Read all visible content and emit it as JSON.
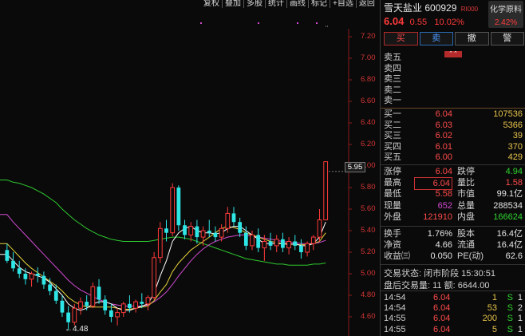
{
  "toolbar": [
    "复权",
    "叠加",
    "多股",
    "统计",
    "画线",
    "标记",
    "+自选",
    "返回"
  ],
  "price_axis": [
    "7.20",
    "7.00",
    "6.80",
    "6.60",
    "6.40",
    "6.20",
    "6.00",
    "5.80",
    "5.60",
    "5.40",
    "5.20",
    "5.00",
    "4.80",
    "4.60"
  ],
  "current_price_label": "5.95",
  "low_marker": "←4.48",
  "colors": {
    "up": "#ff3a3a",
    "down": "#2fe6e6",
    "ma5": "#ffffff",
    "ma10": "#e6d23a",
    "ma20": "#d04ad0",
    "ma60": "#2ec82e"
  },
  "header": {
    "name": "雪天盐业",
    "code": "600929",
    "badge": "RI000",
    "price": "6.04",
    "change": "0.55",
    "pct": "10.02%",
    "sector_name": "化学原料",
    "sector_pct": "2.42%"
  },
  "buttons": {
    "buy": "买",
    "sell": "卖",
    "cancel": "撤",
    "alert": "警"
  },
  "collapse_icon": "⌃⌃",
  "asks": [
    {
      "label": "卖五",
      "price": "",
      "vol": ""
    },
    {
      "label": "卖四",
      "price": "",
      "vol": ""
    },
    {
      "label": "卖三",
      "price": "",
      "vol": ""
    },
    {
      "label": "卖二",
      "price": "",
      "vol": ""
    },
    {
      "label": "卖一",
      "price": "",
      "vol": ""
    }
  ],
  "bids": [
    {
      "label": "买一",
      "price": "6.04",
      "vol": "107536"
    },
    {
      "label": "买二",
      "price": "6.03",
      "vol": "5366"
    },
    {
      "label": "买三",
      "price": "6.02",
      "vol": "39"
    },
    {
      "label": "买四",
      "price": "6.01",
      "vol": "370"
    },
    {
      "label": "买五",
      "price": "6.00",
      "vol": "429"
    }
  ],
  "stats": [
    {
      "l1": "涨停",
      "v1": "6.04",
      "c1": "red",
      "l2": "跌停",
      "v2": "4.94",
      "c2": "green"
    },
    {
      "l1": "最高",
      "v1": "6.04",
      "c1": "red",
      "l2": "量比",
      "v2": "1.58",
      "c2": "red"
    },
    {
      "l1": "最低",
      "v1": "5.58",
      "c1": "red",
      "l2": "市值",
      "v2": "99.1亿",
      "c2": "white"
    },
    {
      "l1": "现量",
      "v1": "652",
      "c1": "magenta",
      "l2": "总量",
      "v2": "288534",
      "c2": "white"
    },
    {
      "l1": "外盘",
      "v1": "121910",
      "c1": "red",
      "l2": "内盘",
      "v2": "166624",
      "c2": "green"
    }
  ],
  "stats2": [
    {
      "l1": "换手",
      "v1": "1.76%",
      "c1": "white",
      "l2": "股本",
      "v2": "16.4亿",
      "c2": "white"
    },
    {
      "l1": "净资",
      "v1": "4.66",
      "c1": "white",
      "l2": "流通",
      "v2": "16.4亿",
      "c2": "white"
    },
    {
      "l1": "收益㈢",
      "v1": "0.050",
      "c1": "white",
      "l2": "PE(动)",
      "v2": "62.6",
      "c2": "white"
    }
  ],
  "status": {
    "trade_status": "交易状态: 闭市阶段 15:30:51",
    "after_hours": "盘后交易量: 11  额: 6644.00"
  },
  "ticks": [
    {
      "time": "14:54",
      "price": "6.04",
      "vol": "1",
      "side": "S",
      "n": "1"
    },
    {
      "time": "14:54",
      "price": "6.04",
      "vol": "53",
      "side": "S",
      "n": "2"
    },
    {
      "time": "14:55",
      "price": "6.04",
      "vol": "200",
      "side": "S",
      "n": "1"
    },
    {
      "time": "14:55",
      "price": "6.04",
      "vol": "5",
      "side": "S",
      "n": "1"
    }
  ],
  "chart_data": {
    "type": "candlestick",
    "ylim": [
      4.45,
      7.3
    ],
    "price_ticks": [
      7.2,
      7.0,
      6.8,
      6.6,
      6.4,
      6.2,
      6.0,
      5.8,
      5.6,
      5.4,
      5.2,
      5.0,
      4.8,
      4.6
    ],
    "candles": [
      [
        5.22,
        5.28,
        5.1,
        5.12
      ],
      [
        5.12,
        5.2,
        5.02,
        5.05
      ],
      [
        5.05,
        5.12,
        4.96,
        5.0
      ],
      [
        5.0,
        5.05,
        4.9,
        4.95
      ],
      [
        4.95,
        5.02,
        4.88,
        5.0
      ],
      [
        5.0,
        5.06,
        4.92,
        4.98
      ],
      [
        4.98,
        5.02,
        4.86,
        4.9
      ],
      [
        4.9,
        4.96,
        4.8,
        4.84
      ],
      [
        4.84,
        4.9,
        4.72,
        4.75
      ],
      [
        4.75,
        4.8,
        4.6,
        4.64
      ],
      [
        4.64,
        4.7,
        4.48,
        4.55
      ],
      [
        4.55,
        4.72,
        4.52,
        4.68
      ],
      [
        4.68,
        4.78,
        4.62,
        4.74
      ],
      [
        4.74,
        4.8,
        4.66,
        4.7
      ],
      [
        4.7,
        4.92,
        4.68,
        4.88
      ],
      [
        4.88,
        4.95,
        4.72,
        4.76
      ],
      [
        4.76,
        4.8,
        4.62,
        4.66
      ],
      [
        4.66,
        4.72,
        4.55,
        4.6
      ],
      [
        4.6,
        4.68,
        4.52,
        4.64
      ],
      [
        4.64,
        4.74,
        4.6,
        4.72
      ],
      [
        4.72,
        4.8,
        4.64,
        4.68
      ],
      [
        4.68,
        4.76,
        4.64,
        4.74
      ],
      [
        4.74,
        4.82,
        4.68,
        4.72
      ],
      [
        4.72,
        4.8,
        4.66,
        4.78
      ],
      [
        4.78,
        5.2,
        4.76,
        5.15
      ],
      [
        5.15,
        5.48,
        5.1,
        5.42
      ],
      [
        5.42,
        5.5,
        5.3,
        5.38
      ],
      [
        5.38,
        5.84,
        5.35,
        5.8
      ],
      [
        5.8,
        5.82,
        5.4,
        5.45
      ],
      [
        5.45,
        5.5,
        5.32,
        5.36
      ],
      [
        5.36,
        5.48,
        5.3,
        5.44
      ],
      [
        5.44,
        5.5,
        5.28,
        5.34
      ],
      [
        5.34,
        5.44,
        5.26,
        5.4
      ],
      [
        5.4,
        5.5,
        5.34,
        5.38
      ],
      [
        5.38,
        5.44,
        5.3,
        5.34
      ],
      [
        5.34,
        5.46,
        5.3,
        5.42
      ],
      [
        5.42,
        5.62,
        5.38,
        5.56
      ],
      [
        5.56,
        5.62,
        5.44,
        5.48
      ],
      [
        5.48,
        5.52,
        5.34,
        5.38
      ],
      [
        5.38,
        5.44,
        5.22,
        5.26
      ],
      [
        5.26,
        5.4,
        5.22,
        5.36
      ],
      [
        5.36,
        5.42,
        5.2,
        5.24
      ],
      [
        5.24,
        5.36,
        5.12,
        5.3
      ],
      [
        5.3,
        5.38,
        5.22,
        5.26
      ],
      [
        5.26,
        5.36,
        5.2,
        5.32
      ],
      [
        5.32,
        5.38,
        5.2,
        5.24
      ],
      [
        5.24,
        5.34,
        5.18,
        5.3
      ],
      [
        5.3,
        5.36,
        5.22,
        5.26
      ],
      [
        5.26,
        5.32,
        5.14,
        5.2
      ],
      [
        5.2,
        5.3,
        5.16,
        5.28
      ],
      [
        5.28,
        5.36,
        5.22,
        5.34
      ],
      [
        5.34,
        5.6,
        5.3,
        5.5
      ],
      [
        5.5,
        6.04,
        5.58,
        6.04
      ]
    ],
    "ma_series": [
      {
        "key": "ma60",
        "values": [
          5.87,
          5.85,
          5.84,
          5.82,
          5.8,
          5.77,
          5.74,
          5.7,
          5.66,
          5.6,
          5.55,
          5.5,
          5.46,
          5.42,
          5.39,
          5.36,
          5.34,
          5.32,
          5.31,
          5.3,
          5.3,
          5.3,
          5.3,
          5.3,
          5.31,
          5.32,
          5.33,
          5.34,
          5.34,
          5.33,
          5.32,
          5.3,
          5.28,
          5.26,
          5.24,
          5.22,
          5.2,
          5.18,
          5.16,
          5.14,
          5.13,
          5.12,
          5.11,
          5.1,
          5.09,
          5.09,
          5.08,
          5.08,
          5.08,
          5.08,
          5.09,
          5.09,
          5.1
        ]
      },
      {
        "key": "ma20",
        "values": [
          5.55,
          5.48,
          5.42,
          5.36,
          5.3,
          5.24,
          5.18,
          5.12,
          5.06,
          5.0,
          4.94,
          4.89,
          4.85,
          4.82,
          4.79,
          4.76,
          4.74,
          4.72,
          4.71,
          4.7,
          4.7,
          4.7,
          4.7,
          4.71,
          4.74,
          4.78,
          4.83,
          4.9,
          4.98,
          5.05,
          5.12,
          5.18,
          5.23,
          5.27,
          5.3,
          5.32,
          5.34,
          5.35,
          5.36,
          5.36,
          5.35,
          5.34,
          5.33,
          5.32,
          5.31,
          5.3,
          5.29,
          5.29,
          5.28,
          5.28,
          5.28,
          5.29,
          5.31
        ]
      },
      {
        "key": "ma10",
        "values": [
          5.28,
          5.22,
          5.16,
          5.1,
          5.05,
          5.01,
          4.97,
          4.93,
          4.89,
          4.84,
          4.78,
          4.74,
          4.71,
          4.69,
          4.69,
          4.69,
          4.69,
          4.69,
          4.68,
          4.67,
          4.67,
          4.68,
          4.69,
          4.7,
          4.75,
          4.83,
          4.9,
          5.02,
          5.1,
          5.16,
          5.22,
          5.26,
          5.3,
          5.34,
          5.38,
          5.42,
          5.44,
          5.43,
          5.41,
          5.38,
          5.36,
          5.34,
          5.32,
          5.3,
          5.29,
          5.28,
          5.28,
          5.27,
          5.27,
          5.27,
          5.28,
          5.3,
          5.38
        ]
      },
      {
        "key": "ma5",
        "values": [
          5.18,
          5.12,
          5.06,
          5.02,
          5.0,
          4.98,
          4.96,
          4.92,
          4.86,
          4.8,
          4.72,
          4.68,
          4.66,
          4.68,
          4.72,
          4.74,
          4.74,
          4.72,
          4.68,
          4.66,
          4.66,
          4.68,
          4.7,
          4.72,
          4.82,
          4.98,
          5.12,
          5.3,
          5.38,
          5.42,
          5.44,
          5.4,
          5.38,
          5.38,
          5.37,
          5.38,
          5.42,
          5.44,
          5.44,
          5.4,
          5.36,
          5.32,
          5.28,
          5.28,
          5.28,
          5.28,
          5.27,
          5.28,
          5.26,
          5.26,
          5.28,
          5.34,
          5.48
        ]
      }
    ]
  }
}
